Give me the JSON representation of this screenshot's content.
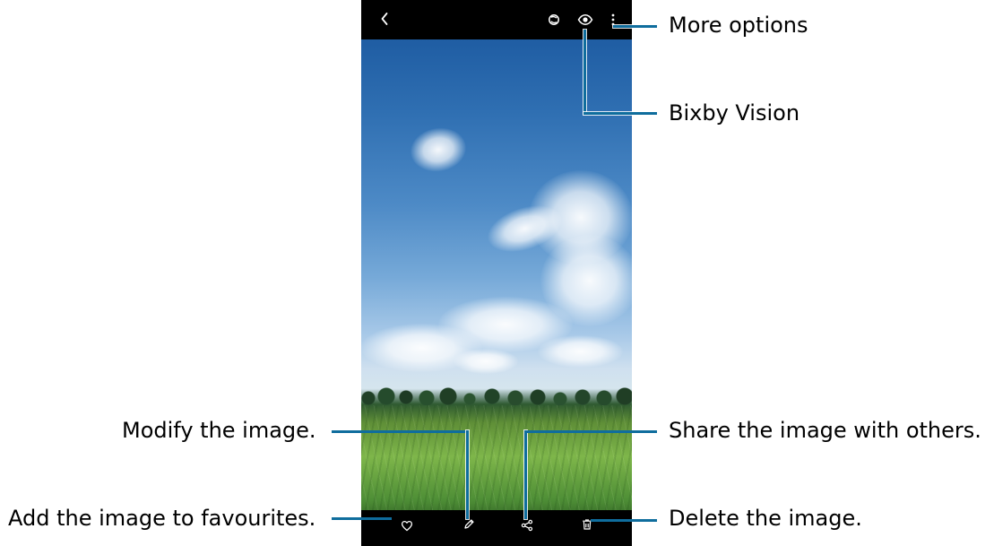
{
  "callouts": {
    "more_options": "More options",
    "bixby_vision": "Bixby Vision",
    "modify_image": "Modify the image.",
    "share_image": "Share the image with others.",
    "add_favourites": "Add the image to favourites.",
    "delete_image": "Delete the image."
  },
  "icons": {
    "back": "chevron-left-icon",
    "remaster": "remaster-icon",
    "bixby": "eye-icon",
    "more": "more-vertical-icon",
    "favourite": "heart-icon",
    "edit": "pencil-icon",
    "share": "share-icon",
    "delete": "trash-icon"
  },
  "colors": {
    "callout_line": "#0f6d9d",
    "phone_bars": "#000000"
  }
}
